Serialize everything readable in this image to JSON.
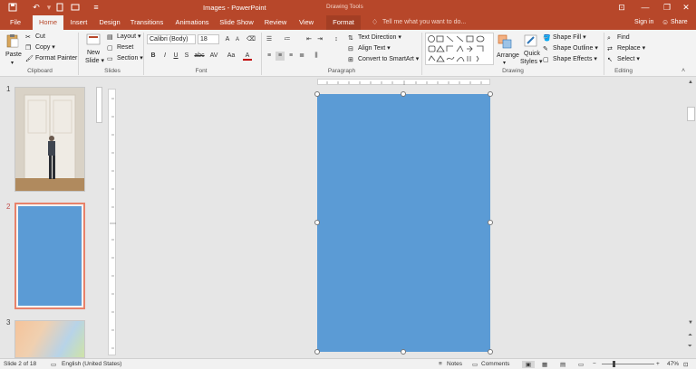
{
  "title_bar": {
    "window_title": "Images - PowerPoint",
    "context_title": "Drawing Tools",
    "icons": [
      "save-icon",
      "undo-icon",
      "redo-icon",
      "customize-icon"
    ]
  },
  "tabs": [
    "File",
    "Home",
    "Insert",
    "Design",
    "Transitions",
    "Animations",
    "Slide Show",
    "Review",
    "View",
    "Format"
  ],
  "active_tab": "Home",
  "tell_me": "Tell me what you want to do...",
  "account": {
    "sign_in": "Sign in",
    "share": "Share"
  },
  "ribbon": {
    "clipboard": {
      "paste": "Paste",
      "cut": "Cut",
      "copy": "Copy",
      "format_painter": "Format Painter",
      "label": "Clipboard"
    },
    "slides": {
      "new_slide": "New",
      "new_slide2": "Slide",
      "layout": "Layout",
      "reset": "Reset",
      "section": "Section",
      "label": "Slides"
    },
    "font": {
      "font_name": "Calibri (Body)",
      "font_size": "18",
      "bold": "B",
      "italic": "I",
      "underline": "U",
      "strike": "S",
      "shadow": "abc",
      "spacing": "AV",
      "case": "Aa",
      "color": "A",
      "label": "Font"
    },
    "paragraph": {
      "text_direction": "Text Direction",
      "align_text": "Align Text",
      "convert_smartart": "Convert to SmartArt",
      "label": "Paragraph"
    },
    "drawing": {
      "arrange": "Arrange",
      "quick_styles": "Quick",
      "quick_styles2": "Styles",
      "shape_fill": "Shape Fill",
      "shape_outline": "Shape Outline",
      "shape_effects": "Shape Effects",
      "label": "Drawing"
    },
    "editing": {
      "find": "Find",
      "replace": "Replace",
      "select": "Select",
      "label": "Editing"
    }
  },
  "slides_panel": [
    {
      "number": "1",
      "selected": false
    },
    {
      "number": "2",
      "selected": true
    },
    {
      "number": "3",
      "selected": false
    }
  ],
  "colors": {
    "accent": "#b7472a",
    "slide_fill": "#5b9bd5"
  },
  "status": {
    "slide": "Slide 2 of 18",
    "language": "English (United States)",
    "notes": "Notes",
    "comments": "Comments",
    "zoom": "47%"
  }
}
